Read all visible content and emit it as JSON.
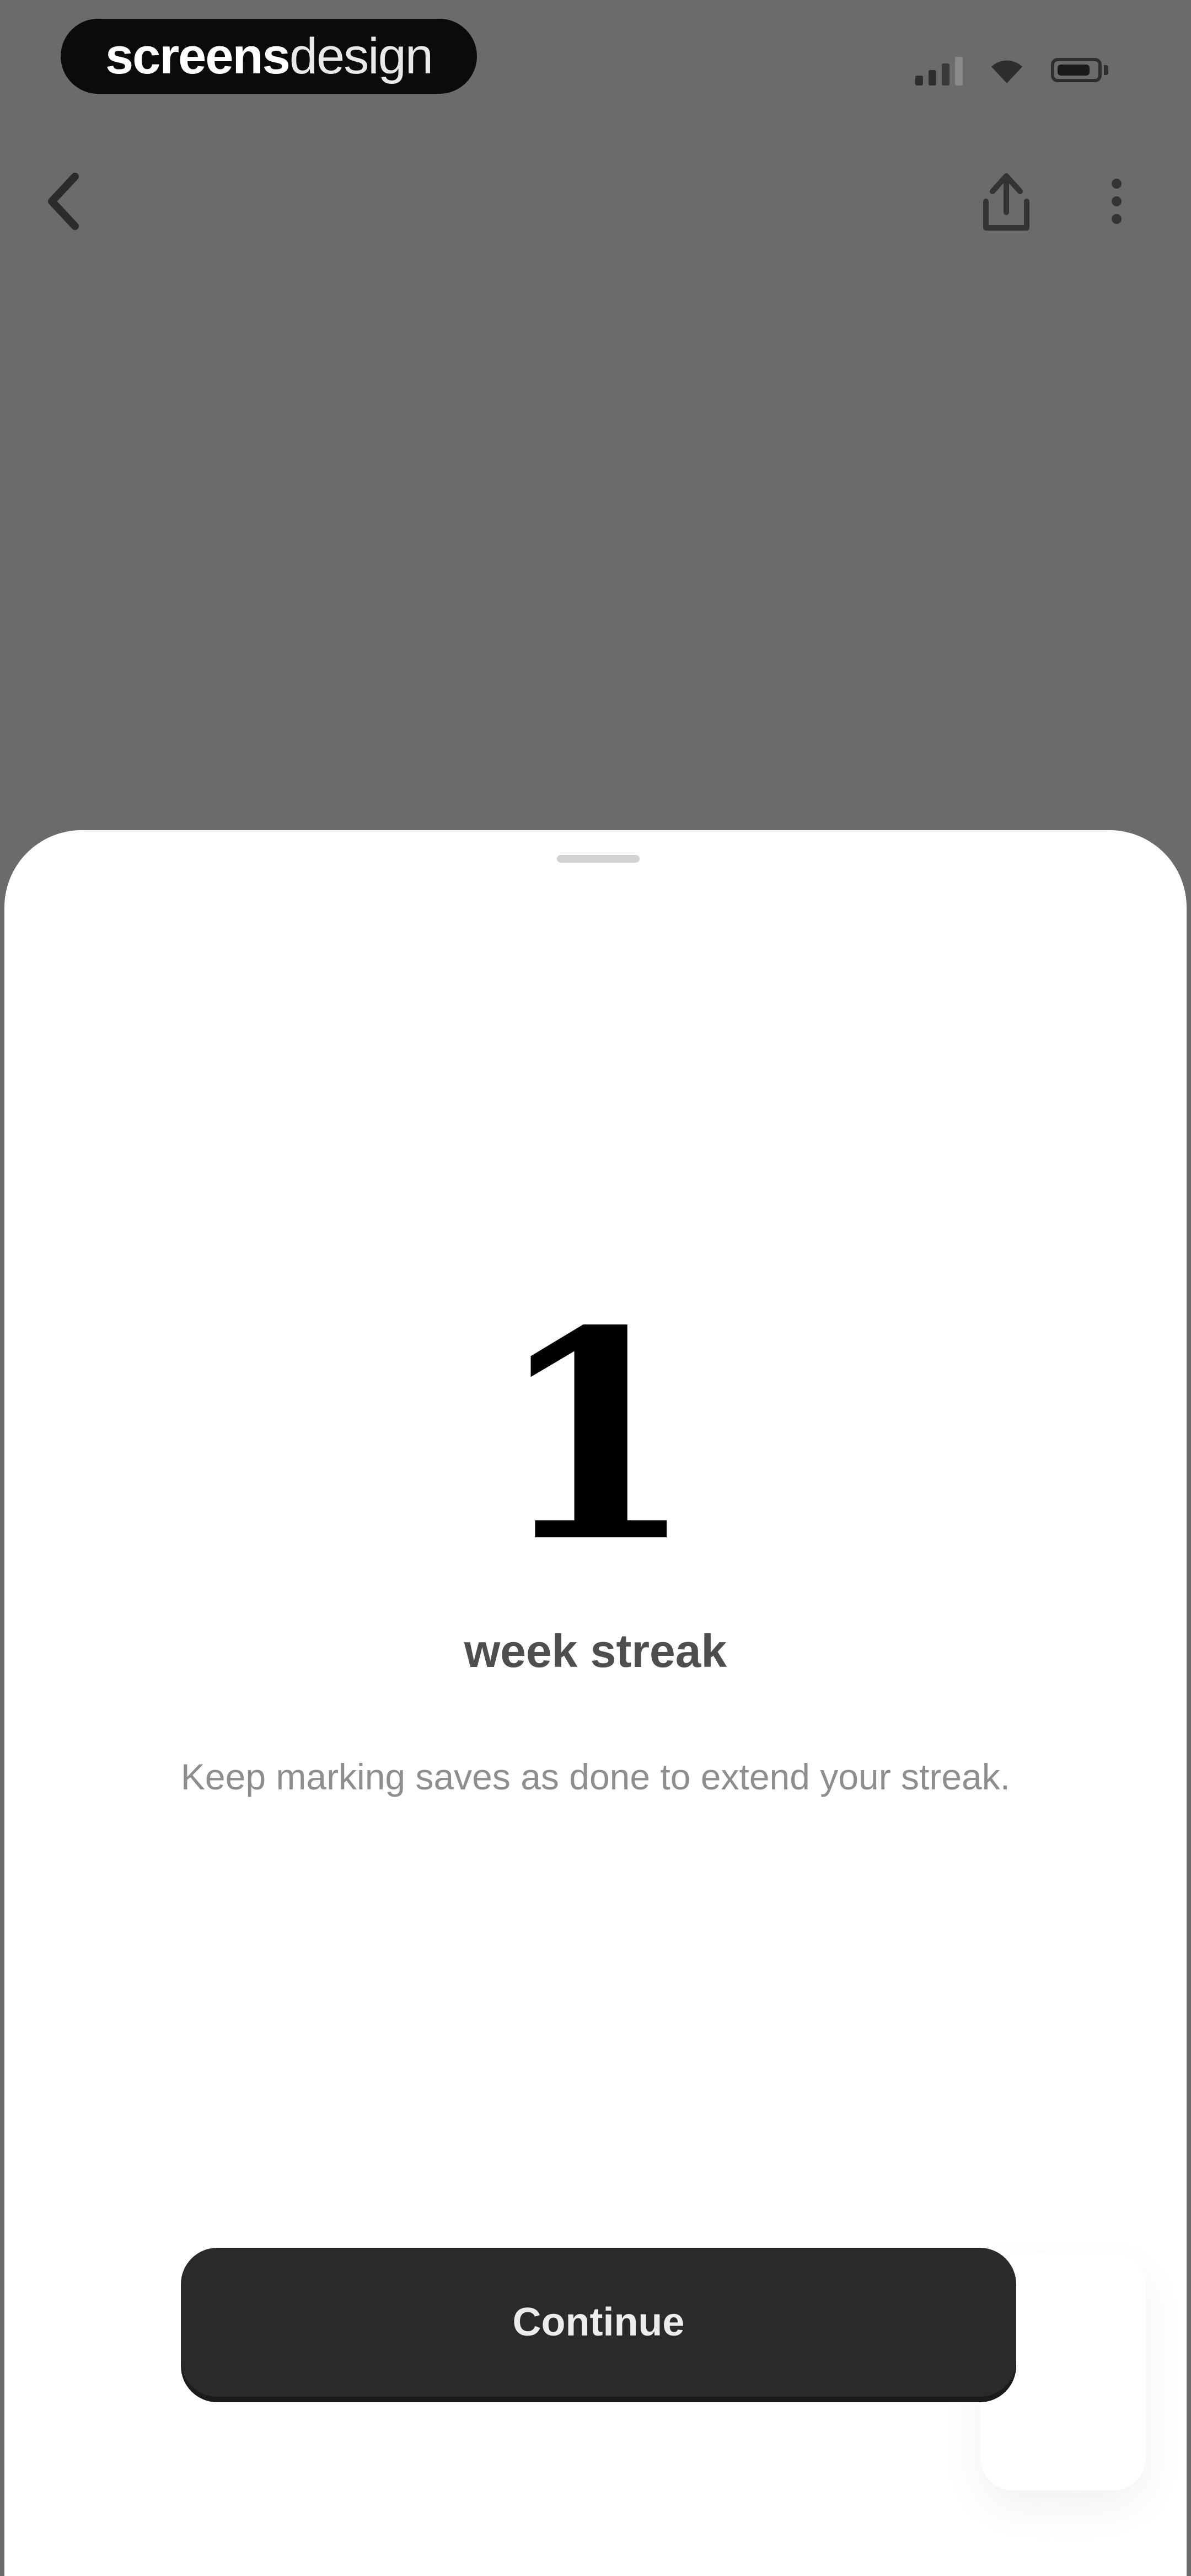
{
  "status_bar": {
    "brand_bold": "screens",
    "brand_light": "design"
  },
  "icons": {
    "back": "chevron-left-icon",
    "share": "share-icon",
    "more": "more-vertical-icon",
    "signal": "cellular-signal-icon",
    "wifi": "wifi-icon",
    "battery": "battery-icon"
  },
  "colors": {
    "backdrop": "#6b6b6b",
    "sheet": "#ffffff",
    "button": "#2a2a2a"
  },
  "streak": {
    "count": "1",
    "label": "week streak",
    "description": "Keep marking saves as done to extend your streak."
  },
  "actions": {
    "continue_label": "Continue"
  }
}
